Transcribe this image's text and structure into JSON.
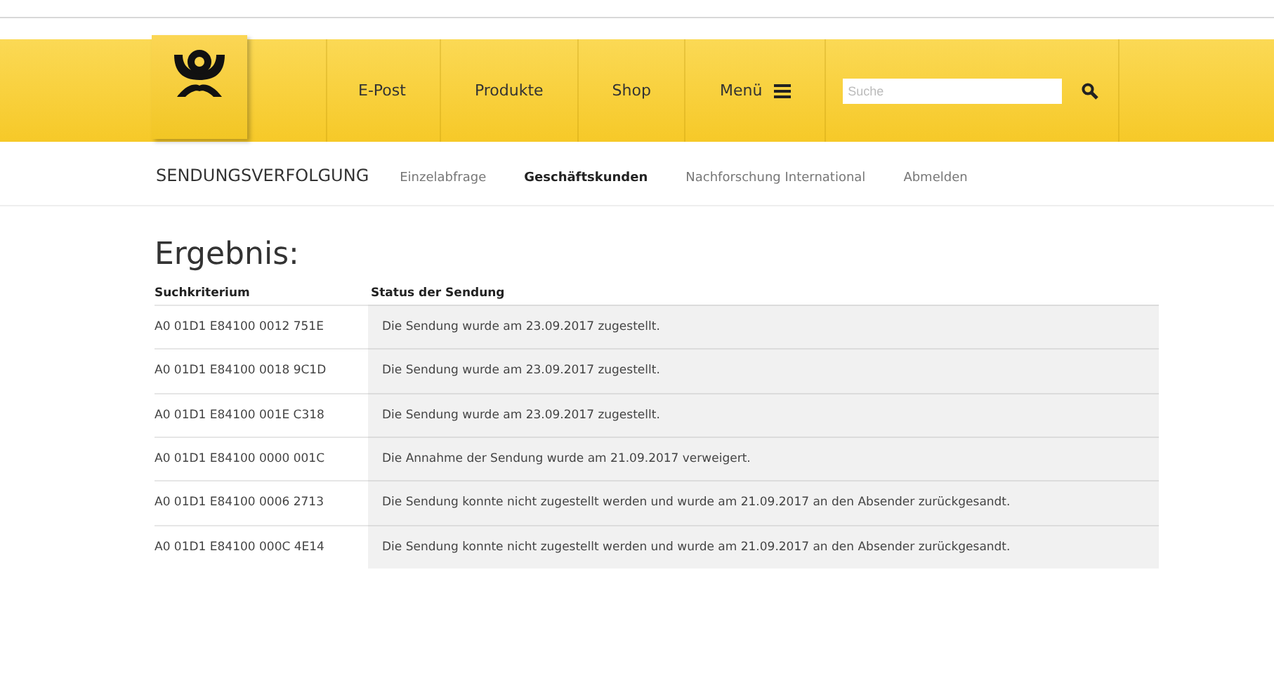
{
  "header": {
    "nav": [
      {
        "label": "E-Post"
      },
      {
        "label": "Produkte"
      },
      {
        "label": "Shop"
      },
      {
        "label": "Menü",
        "kind": "menu"
      }
    ],
    "search": {
      "placeholder": "Suche"
    }
  },
  "subnav": {
    "title": "SENDUNGSVERFOLGUNG",
    "items": [
      {
        "label": "Einzelabfrage",
        "selected": false
      },
      {
        "label": "Geschäftskunden",
        "selected": true
      },
      {
        "label": "Nachforschung International",
        "selected": false
      },
      {
        "label": "Abmelden",
        "selected": false
      }
    ]
  },
  "heading": "Ergebnis:",
  "table": {
    "columns": [
      "Suchkriterium",
      "Status der Sendung"
    ],
    "rows": [
      {
        "id": "A0 01D1 E84100 0012 751E",
        "status": "Die Sendung wurde am 23.09.2017 zugestellt."
      },
      {
        "id": "A0 01D1 E84100 0018 9C1D",
        "status": "Die Sendung wurde am 23.09.2017 zugestellt."
      },
      {
        "id": "A0 01D1 E84100 001E C318",
        "status": "Die Sendung wurde am 23.09.2017 zugestellt."
      },
      {
        "id": "A0 01D1 E84100 0000 001C",
        "status": "Die Annahme der Sendung wurde am 21.09.2017 verweigert."
      },
      {
        "id": "A0 01D1 E84100 0006 2713",
        "status": "Die Sendung konnte nicht zugestellt werden und wurde am 21.09.2017 an den Absender zurückgesandt."
      },
      {
        "id": "A0 01D1 E84100 000C 4E14",
        "status": "Die Sendung konnte nicht zugestellt werden und wurde am 21.09.2017 an den Absender zurückgesandt."
      }
    ]
  }
}
